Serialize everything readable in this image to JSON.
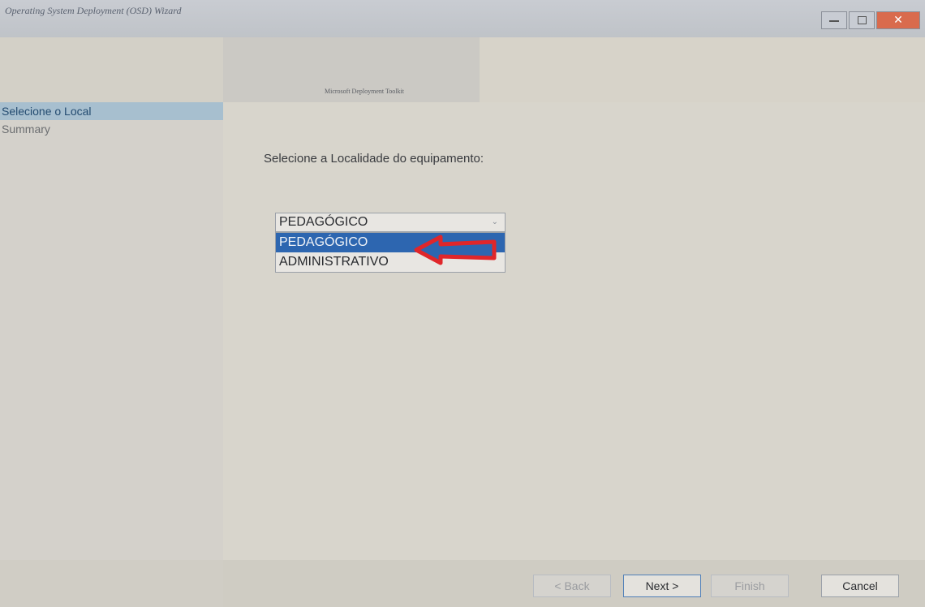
{
  "window": {
    "title": "Operating System Deployment (OSD) Wizard",
    "close_glyph": "✕"
  },
  "banner": {
    "logo_text": "Microsoft Deployment Toolkit"
  },
  "sidebar": {
    "items": [
      {
        "label": "Selecione o Local",
        "selected": true
      },
      {
        "label": "Summary",
        "selected": false
      }
    ]
  },
  "main": {
    "prompt": "Selecione a Localidade do equipamento:",
    "combo": {
      "selected_value": "PEDAGÓGICO",
      "arrow_glyph": "⌄",
      "options": [
        "PEDAGÓGICO",
        "ADMINISTRATIVO"
      ],
      "highlighted_index": 0
    },
    "annotation": {
      "color": "#e0262a",
      "icon": "arrow-left-icon"
    }
  },
  "buttons": {
    "back": "< Back",
    "next": "Next >",
    "finish": "Finish",
    "cancel": "Cancel"
  },
  "colors": {
    "selection": "#2d66b0",
    "sidebar_selected": "#a7bfcf",
    "close_button": "#d96b4d"
  }
}
